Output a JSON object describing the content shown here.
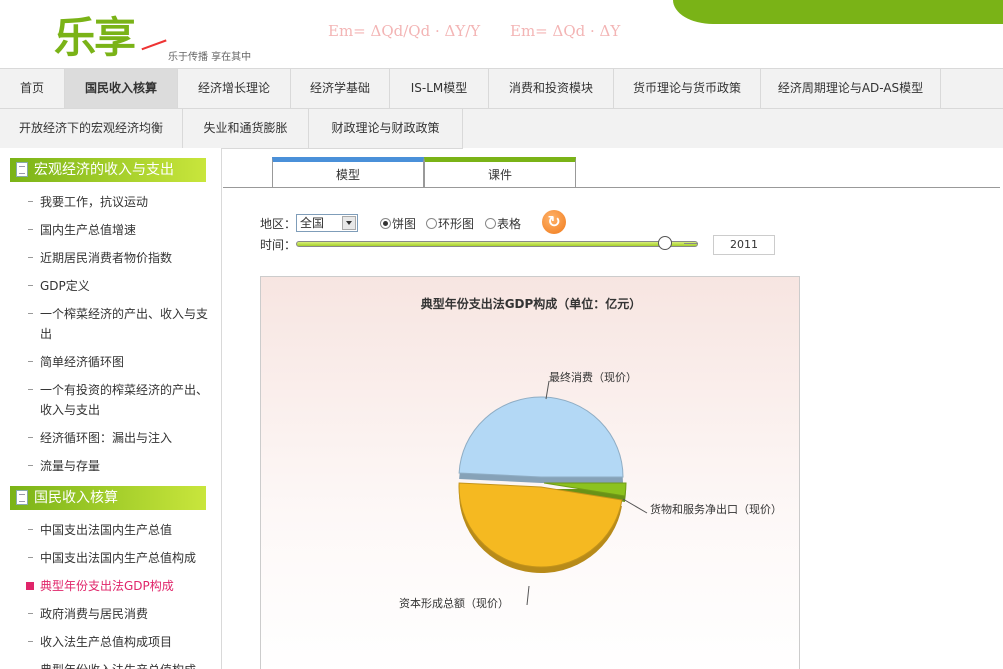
{
  "header": {
    "logo_text": "乐享",
    "tagline": "乐于传播 享在其中",
    "formula1": "Em= ΔQd/Qd · ΔY/Y",
    "formula2": "Em= ΔQd · ΔY"
  },
  "nav": {
    "row1": [
      {
        "label": "首页",
        "active": false
      },
      {
        "label": "国民收入核算",
        "active": true
      },
      {
        "label": "经济增长理论",
        "active": false
      },
      {
        "label": "经济学基础",
        "active": false
      },
      {
        "label": "IS-LM模型",
        "active": false
      },
      {
        "label": "消费和投资模块",
        "active": false
      },
      {
        "label": "货币理论与货币政策",
        "active": false
      },
      {
        "label": "经济周期理论与AD-AS模型",
        "active": false
      }
    ],
    "row2": [
      {
        "label": "开放经济下的宏观经济均衡"
      },
      {
        "label": "失业和通货膨胀"
      },
      {
        "label": "财政理论与财政政策"
      }
    ]
  },
  "sidebar": {
    "section1": {
      "title": "宏观经济的收入与支出",
      "items": [
        "我要工作，抗议运动",
        "国内生产总值增速",
        "近期居民消费者物价指数",
        "GDP定义",
        "一个榨菜经济的产出、收入与支出",
        "简单经济循环图",
        "一个有投资的榨菜经济的产出、收入与支出",
        "经济循环图：漏出与注入",
        "流量与存量"
      ]
    },
    "section2": {
      "title": "国民收入核算",
      "items": [
        "中国支出法国内生产总值",
        "中国支出法国内生产总值构成",
        "典型年份支出法GDP构成",
        "政府消费与居民消费",
        "收入法生产总值构成项目",
        "典型年份收入法生产总值构成"
      ],
      "active_index": 2
    }
  },
  "tabs": {
    "model": "模型",
    "courseware": "课件"
  },
  "controls": {
    "region_label": "地区：",
    "region_value": "全国",
    "chart_types": [
      {
        "label": "饼图",
        "checked": true
      },
      {
        "label": "环形图",
        "checked": false
      },
      {
        "label": "表格",
        "checked": false
      }
    ],
    "time_label": "时间：",
    "year": "2011",
    "slider_fraction": 0.95
  },
  "chart_data": {
    "type": "pie",
    "title": "典型年份支出法GDP构成（单位：亿元）",
    "slices": [
      {
        "name": "最终消费（现价）",
        "share": 0.492,
        "color": "#b3d8f5"
      },
      {
        "name": "货物和服务净出口（现价）",
        "share": 0.026,
        "color": "#8cc21e"
      },
      {
        "name": "资本形成总额（现价）",
        "share": 0.482,
        "color": "#f5b921"
      }
    ]
  }
}
